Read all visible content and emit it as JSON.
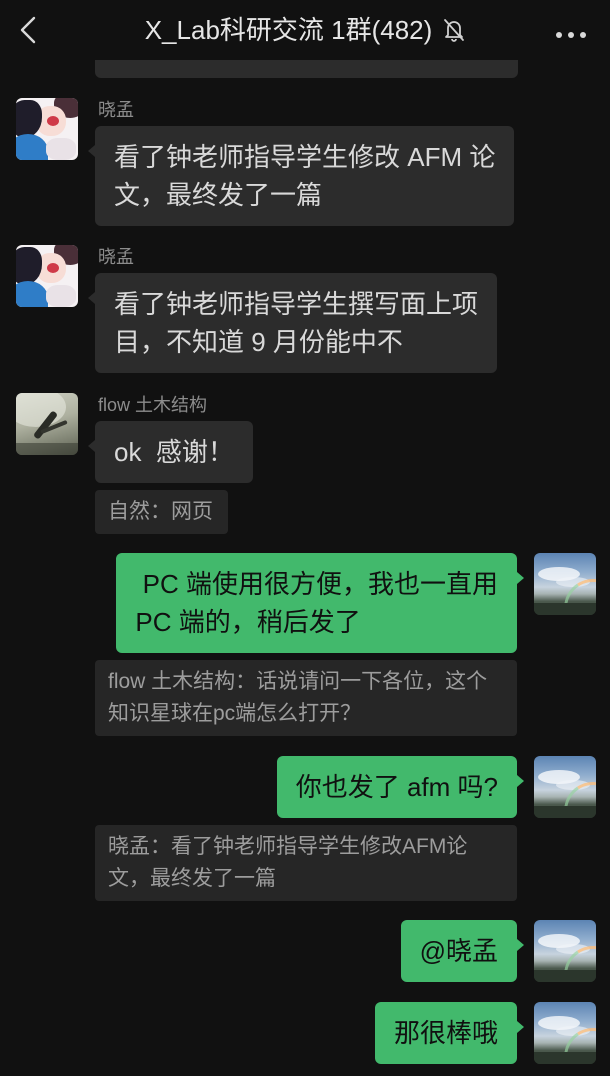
{
  "header": {
    "title": "X_Lab科研交流 1群(482)",
    "back_icon": "chevron-left-icon",
    "mute_icon": "bell-off-icon",
    "more_icon": "more-dots-icon"
  },
  "colors": {
    "background": "#111111",
    "incoming_bubble": "#2c2c2c",
    "outgoing_bubble": "#42b96c",
    "quote_background": "#262626",
    "sender_name": "#8c8c8c",
    "incoming_text": "#d9d9d9",
    "outgoing_text": "#101010",
    "quote_text": "#9d9d9d",
    "header_text": "#e6e6e6"
  },
  "messages": [
    {
      "outgoing": false,
      "sender": "晓孟",
      "avatar": "anime-girl-avatar",
      "lines": [
        "看了钟老师指导学生修改 AFM 论",
        "文，最终发了一篇"
      ]
    },
    {
      "outgoing": false,
      "sender": "晓孟",
      "avatar": "anime-girl-avatar",
      "lines": [
        "看了钟老师指导学生撰写面上项",
        "目，不知道 9 月份能中不"
      ]
    },
    {
      "outgoing": false,
      "sender": "flow 土木结构",
      "avatar": "misty-landscape-avatar",
      "lines": [
        "ok  感谢！"
      ],
      "quote_lines": [
        "自然：网页"
      ]
    },
    {
      "outgoing": true,
      "avatar": "rainbow-sky-avatar",
      "lines": [
        " PC 端使用很方便，我也一直用",
        "PC 端的，稍后发了"
      ],
      "quote_lines": [
        "flow 土木结构：话说请问一下各位，这个",
        "知识星球在pc端怎么打开？"
      ]
    },
    {
      "outgoing": true,
      "avatar": "rainbow-sky-avatar",
      "lines": [
        "你也发了 afm 吗?"
      ],
      "quote_lines": [
        "晓孟：看了钟老师指导学生修改AFM论",
        "文，最终发了一篇"
      ]
    },
    {
      "outgoing": true,
      "avatar": "rainbow-sky-avatar",
      "lines": [
        "@晓孟"
      ]
    },
    {
      "outgoing": true,
      "avatar": "rainbow-sky-avatar",
      "lines": [
        "那很棒哦"
      ]
    }
  ]
}
